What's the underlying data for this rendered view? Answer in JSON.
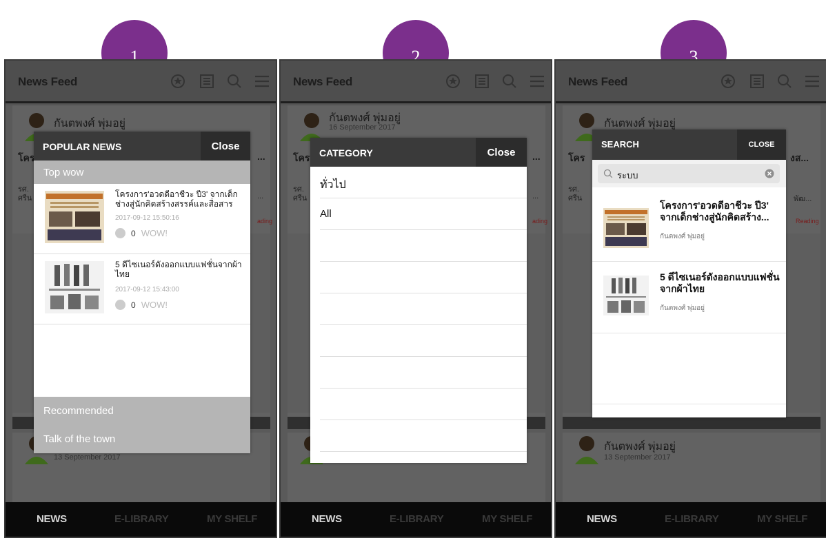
{
  "steps": [
    "1",
    "2",
    "3"
  ],
  "app": {
    "title": "News Feed",
    "nav": [
      "NEWS",
      "E-LIBRARY",
      "MY SHELF"
    ],
    "icons": [
      "star-badge-icon",
      "library-icon",
      "search-icon",
      "menu-icon"
    ]
  },
  "feed_bg": {
    "author": "กันตพงศ์ พุ่มอยู่",
    "date1": "16 September 2017",
    "date2": "13 September 2017",
    "title_frag1": "โคร",
    "title_frag2": "...",
    "title_frag3": "งส...",
    "sub_frag1": "รศ.",
    "sub_frag2": "ศรีน",
    "sub_frag3": "...",
    "sub_frag4": "พัฒ...",
    "reading1": "ading",
    "reading3": "Reading"
  },
  "popular": {
    "header": "POPULAR NEWS",
    "close": "Close",
    "top_section": "Top wow",
    "items": [
      {
        "title": "โครงการ'อวดดีอาชีวะ ปี3' จากเด็กช่างสู่นักคิดสร้างสรรค์และสื่อสาร",
        "date": "2017-09-12 15:50:16",
        "count": "0",
        "wow": "WOW!"
      },
      {
        "title": "5 ดีไซเนอร์ดังออกแบบแฟชั่นจากผ้าไทย",
        "date": "2017-09-12 15:43:00",
        "count": "0",
        "wow": "WOW!"
      }
    ],
    "recommended": "Recommended",
    "talk": "Talk of the town"
  },
  "category": {
    "header": "CATEGORY",
    "close": "Close",
    "items": [
      "ทั่วไป",
      "All"
    ]
  },
  "search": {
    "header": "SEARCH",
    "close": "CLOSE",
    "query": "ระบบ",
    "results": [
      {
        "title": "โครงการ'อวดดีอาชีวะ ปี3' จากเด็กช่างสู่นักคิดสร้าง...",
        "author": "กันตพงศ์ พุ่มอยู่"
      },
      {
        "title": "5 ดีไซเนอร์ดังออกแบบแฟชั่นจากผ้าไทย",
        "author": "กันตพงศ์ พุ่มอยู่"
      }
    ]
  }
}
